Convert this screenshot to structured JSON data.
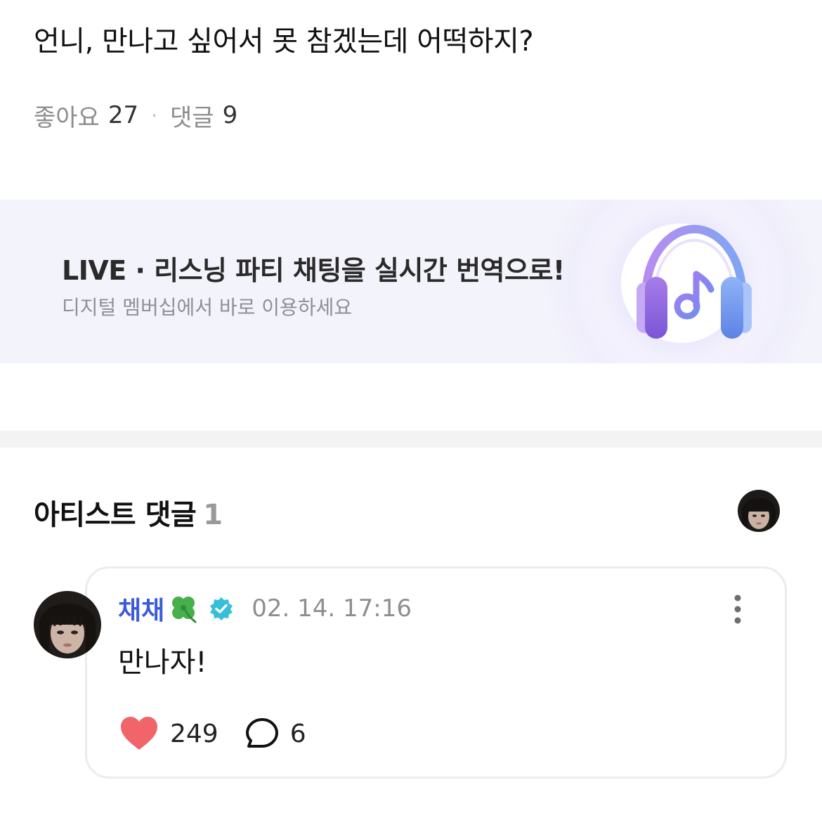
{
  "post": {
    "text": "언니, 만나고 싶어서 못 참겠는데 어떡하지?",
    "likes_label": "좋아요",
    "likes_count": "27",
    "separator": "·",
    "comments_label": "댓글",
    "comments_count": "9"
  },
  "banner": {
    "title": "LIVE · 리스닝 파티 채팅을 실시간 번역으로!",
    "subtitle": "디지털 멤버십에서 바로 이용하세요",
    "icon": "headphones-music-icon"
  },
  "artist_comments": {
    "title": "아티스트 댓글",
    "count": "1"
  },
  "comment": {
    "author": "채채",
    "author_emoji": "clover-emoji",
    "verified_icon": "verified-badge-icon",
    "timestamp": "02. 14. 17:16",
    "text": "만나자!",
    "like_count": "249",
    "reply_count": "6"
  },
  "colors": {
    "accent": "#3b5bdb",
    "heart": "#f0646a",
    "verified": "#36c0d8",
    "banner_bg": "#f3f3fb"
  }
}
